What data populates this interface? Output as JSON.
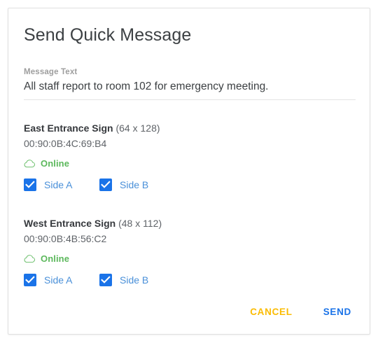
{
  "dialog": {
    "title": "Send Quick Message",
    "message_field": {
      "label": "Message Text",
      "value": "All staff report to room 102 for emergency meeting.",
      "placeholder": "Message Text"
    },
    "signs": [
      {
        "name": "East Entrance Sign",
        "dimensions": "(64 x 128)",
        "mac": "00:90:0B:4C:69:B4",
        "status": "Online",
        "status_icon": "cloud-icon",
        "status_color": "#5cb85c",
        "sides": [
          {
            "label": "Side A",
            "checked": true
          },
          {
            "label": "Side B",
            "checked": true
          }
        ]
      },
      {
        "name": "West Entrance Sign",
        "dimensions": "(48 x 112)",
        "mac": "00:90:0B:4B:56:C2",
        "status": "Online",
        "status_icon": "cloud-icon",
        "status_color": "#5cb85c",
        "sides": [
          {
            "label": "Side A",
            "checked": true
          },
          {
            "label": "Side B",
            "checked": true
          }
        ]
      }
    ],
    "actions": {
      "cancel_label": "CANCEL",
      "send_label": "SEND",
      "cancel_color": "#fbbc04",
      "send_color": "#1a73e8"
    }
  },
  "colors": {
    "accent": "#1a73e8",
    "checkbox_fill": "#1a73e8",
    "checkbox_label": "#4a90d9",
    "online_green": "#5cb85c",
    "cancel_amber": "#fbbc04",
    "card_border": "#e0e0e0"
  }
}
